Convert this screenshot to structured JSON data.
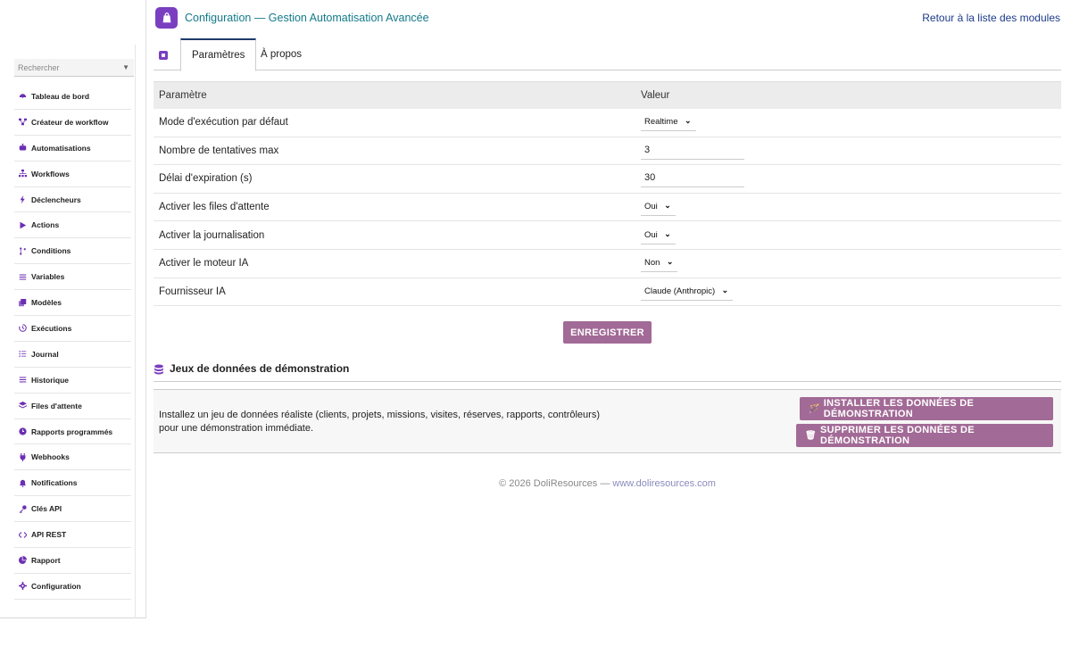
{
  "header": {
    "title": "Configuration — Gestion Automatisation Avancée",
    "back_link": "Retour à la liste des modules"
  },
  "sidebar": {
    "search_placeholder": "Rechercher",
    "items": [
      {
        "label": "Tableau de bord",
        "icon": "dashboard-icon"
      },
      {
        "label": "Créateur de workflow",
        "icon": "workflow-builder-icon"
      },
      {
        "label": "Automatisations",
        "icon": "robot-icon"
      },
      {
        "label": "Workflows",
        "icon": "sitemap-icon"
      },
      {
        "label": "Déclencheurs",
        "icon": "bolt-icon"
      },
      {
        "label": "Actions",
        "icon": "play-icon"
      },
      {
        "label": "Conditions",
        "icon": "branch-icon"
      },
      {
        "label": "Variables",
        "icon": "list-icon"
      },
      {
        "label": "Modèles",
        "icon": "copy-icon"
      },
      {
        "label": "Exécutions",
        "icon": "history-icon"
      },
      {
        "label": "Journal",
        "icon": "list-ul-icon"
      },
      {
        "label": "Historique",
        "icon": "bars-icon"
      },
      {
        "label": "Files d'attente",
        "icon": "layers-icon"
      },
      {
        "label": "Rapports programmés",
        "icon": "clock-icon"
      },
      {
        "label": "Webhooks",
        "icon": "plug-icon"
      },
      {
        "label": "Notifications",
        "icon": "bell-icon"
      },
      {
        "label": "Clés API",
        "icon": "key-icon"
      },
      {
        "label": "API REST",
        "icon": "code-icon"
      },
      {
        "label": "Rapport",
        "icon": "pie-chart-icon"
      },
      {
        "label": "Configuration",
        "icon": "cog-icon"
      }
    ]
  },
  "tabs": [
    {
      "label": "Paramètres",
      "active": true
    },
    {
      "label": "À propos",
      "active": false
    }
  ],
  "params_table": {
    "headers": [
      "Paramètre",
      "Valeur"
    ],
    "rows": [
      {
        "label": "Mode d'exécution par défaut",
        "type": "select",
        "value": "Realtime"
      },
      {
        "label": "Nombre de tentatives max",
        "type": "input",
        "value": "3"
      },
      {
        "label": "Délai d'expiration (s)",
        "type": "input",
        "value": "30"
      },
      {
        "label": "Activer les files d'attente",
        "type": "select",
        "value": "Oui"
      },
      {
        "label": "Activer la journalisation",
        "type": "select",
        "value": "Oui"
      },
      {
        "label": "Activer le moteur IA",
        "type": "select",
        "value": "Non"
      },
      {
        "label": "Fournisseur IA",
        "type": "select",
        "value": "Claude (Anthropic)"
      }
    ]
  },
  "save_label": "ENREGISTRER",
  "demo": {
    "title": "Jeux de données de démonstration",
    "description": "Installez un jeu de données réaliste (clients, projets, missions, visites, réserves, rapports, contrôleurs) pour une démonstration immédiate.",
    "install_label": "INSTALLER LES DONNÉES DE DÉMONSTRATION",
    "delete_label": "SUPPRIMER LES DONNÉES DE DÉMONSTRATION"
  },
  "footer": {
    "copyright": "© 2026 DoliResources — ",
    "link": "www.doliresources.com"
  },
  "colors": {
    "accent": "#7a3fc0",
    "button": "#a26a96",
    "title": "#147a8a",
    "link": "#1d3a8a"
  }
}
